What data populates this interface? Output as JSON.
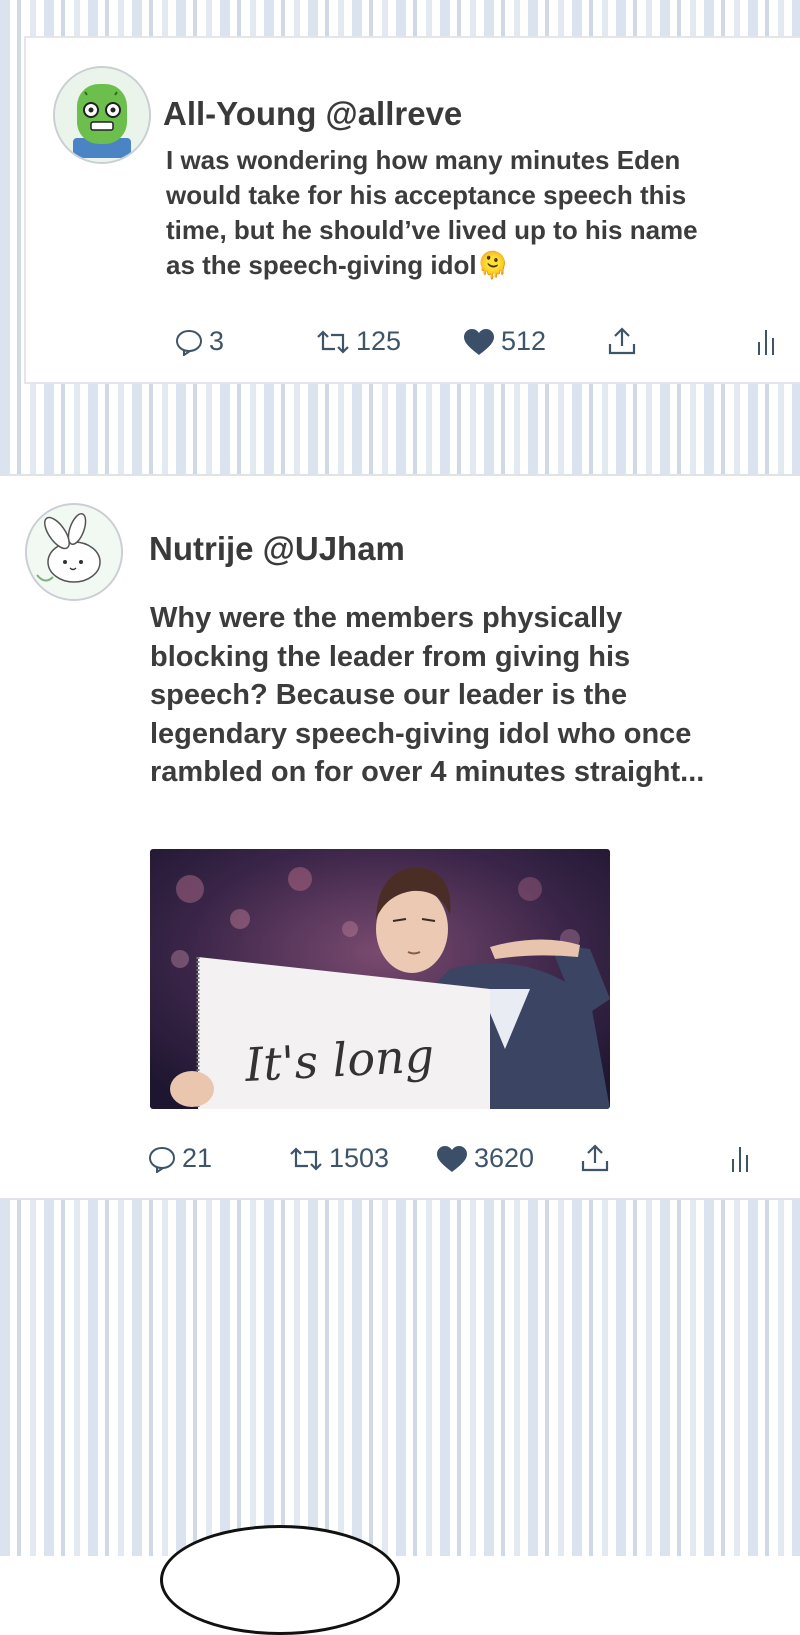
{
  "posts": [
    {
      "username": "All-Young @allreve",
      "text": "I was wondering how many minutes Eden\nwould take for his acceptance speech this\ntime, but he should’ve lived up to his name\nas the speech-giving idol🫠",
      "replies": "3",
      "retweets": "125",
      "likes": "512",
      "avatar_icon": "cactus-avatar-icon"
    },
    {
      "username": "Nutrije @UJham",
      "text": "Why were the members physically\nblocking the leader from giving his\nspeech? Because our leader is the\nlegendary speech-giving idol who once\nrambled on for over 4 minutes straight...",
      "image_caption": "It's long",
      "replies": "21",
      "retweets": "1503",
      "likes": "3620",
      "avatar_icon": "bunny-avatar-icon"
    }
  ],
  "colors": {
    "stripe_blue": "#dbe4ee",
    "action_icon": "#3e5569",
    "like_heart": "#3b5068",
    "text": "#3c3c3c"
  }
}
